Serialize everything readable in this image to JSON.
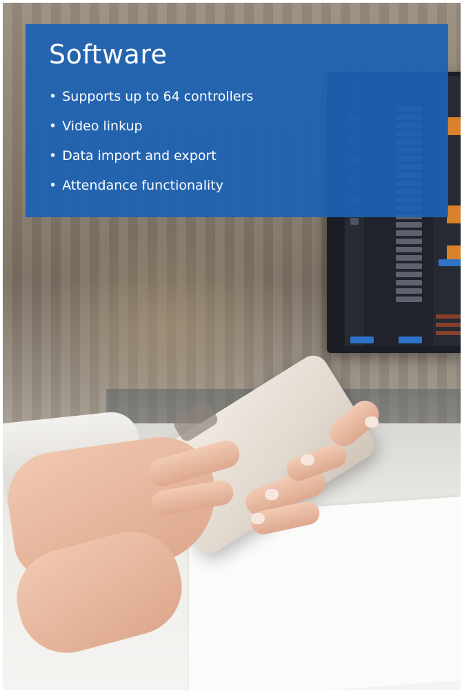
{
  "slide": {
    "title": "Software",
    "bullet_glyph": "•",
    "bullets": [
      "Supports up to 64 controllers",
      "Video linkup",
      "Data import and export",
      "Attendance functionality"
    ]
  },
  "colors": {
    "panel": "#1b62b4",
    "text": "#ffffff"
  }
}
